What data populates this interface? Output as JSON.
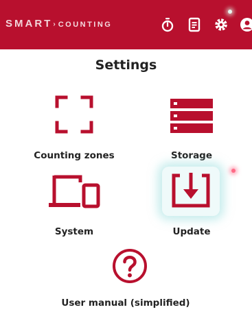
{
  "header": {
    "brand_part1": "SMA",
    "brand_part2": "RT",
    "brand_arrow": "›",
    "brand_part3": "COUNTING",
    "icons": [
      "stopwatch-icon",
      "document-list-icon",
      "gear-icon",
      "user-icon"
    ]
  },
  "page": {
    "title": "Settings"
  },
  "tiles": [
    {
      "label": "Counting zones",
      "icon": "frame-corners-icon"
    },
    {
      "label": "Storage",
      "icon": "server-rack-icon"
    },
    {
      "label": "System",
      "icon": "laptop-phone-icon"
    },
    {
      "label": "Update",
      "icon": "download-box-icon"
    },
    {
      "label": "User manual (simplified)",
      "icon": "question-circle-icon"
    }
  ],
  "colors": {
    "brand": "#b8102e",
    "icon": "#b8102e",
    "text": "#222222",
    "background": "#ffffff"
  }
}
